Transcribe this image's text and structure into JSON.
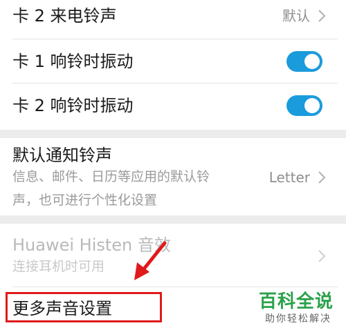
{
  "settings": {
    "card2_ringtone": {
      "label": "卡 2 来电铃声",
      "value": "默认"
    },
    "card1_vibrate": {
      "label": "卡 1 响铃时振动",
      "enabled": true
    },
    "card2_vibrate": {
      "label": "卡 2 响铃时振动",
      "enabled": true
    },
    "default_notification": {
      "label": "默认通知铃声",
      "description_line1": "信息、邮件、日历等应用的默认铃",
      "description_line2": "声，也可进行个性化设置",
      "value": "Letter"
    },
    "histen": {
      "label": "Huawei Histen 音效",
      "description": "连接耳机时可用",
      "disabled": true
    },
    "more_sound": {
      "label": "更多声音设置"
    }
  },
  "watermark": {
    "title": "百科全说",
    "subtitle": "助你轻松解决"
  },
  "colors": {
    "toggle_on": "#1a9bdc",
    "annotation_red": "#e0191b",
    "watermark_green": "#2aa14a",
    "section_gap": "#ececec"
  }
}
